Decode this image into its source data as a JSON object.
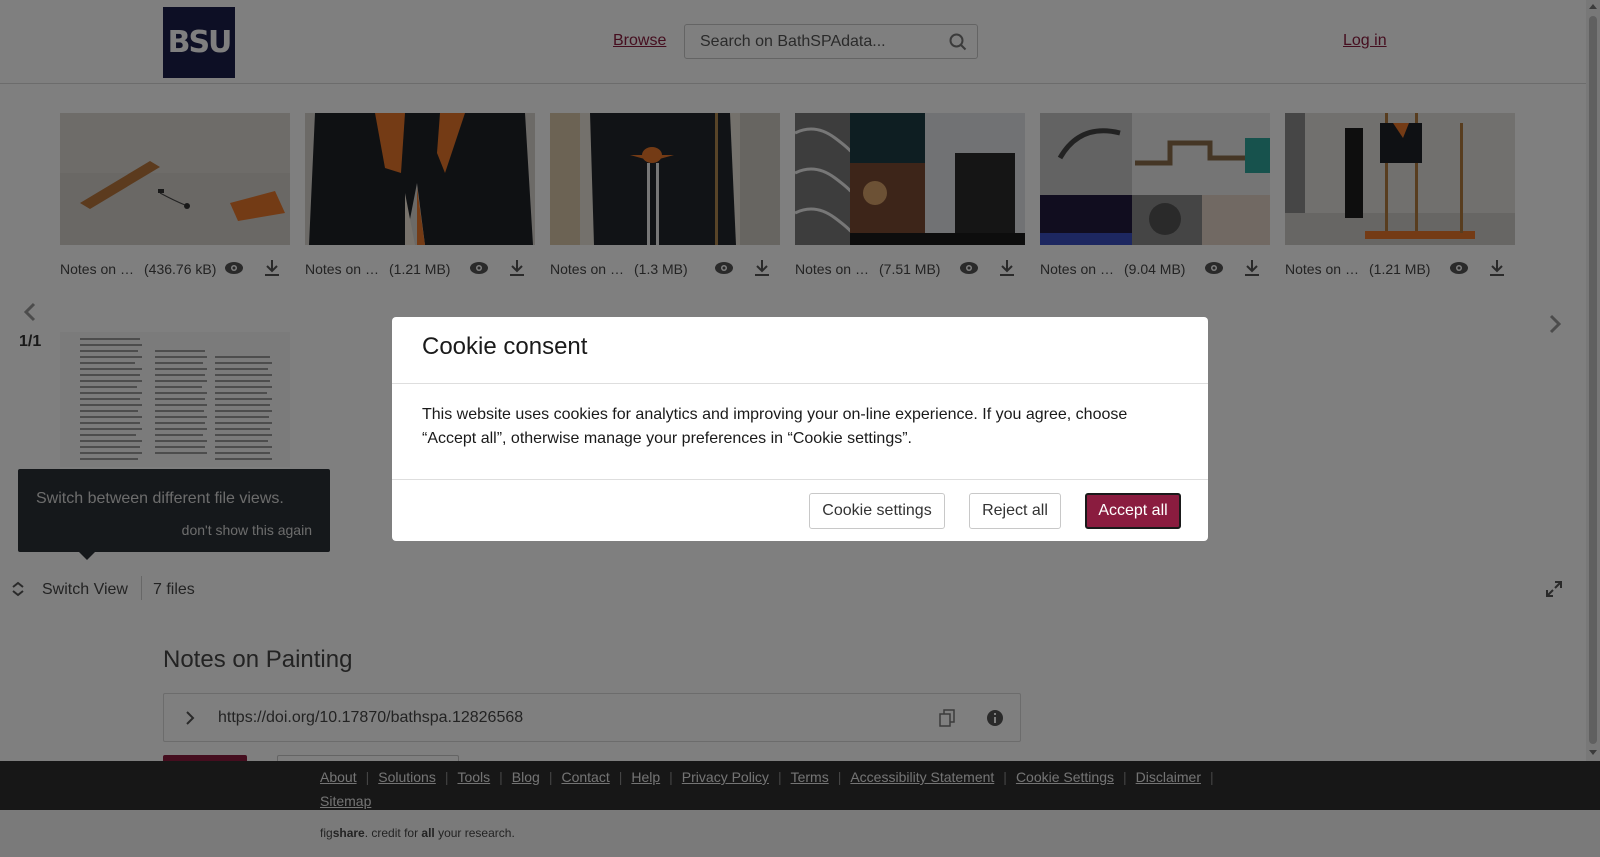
{
  "header": {
    "logo_text": "BSU",
    "browse": "Browse",
    "search_placeholder": "Search on BathSPAdata...",
    "login": "Log in"
  },
  "carousel": {
    "files": [
      {
        "name": "Notes on Painting",
        "size": "(436.76 kB)"
      },
      {
        "name": "Notes on Painting",
        "size": "(1.21 MB)"
      },
      {
        "name": "Notes on Painting",
        "size": "(1.3 MB)"
      },
      {
        "name": "Notes on Painting",
        "size": "(7.51 MB)"
      },
      {
        "name": "Notes on Painting",
        "size": "(9.04 MB)"
      },
      {
        "name": "Notes on Painting",
        "size": "(1.21 MB)"
      }
    ],
    "page_indicator": "1/1",
    "tooltip_text": "Switch between different file views.",
    "tooltip_dismiss": "don't show this again",
    "switch_view": "Switch View",
    "files_count": "7 files"
  },
  "item": {
    "title": "Notes on Painting",
    "doi": "https://doi.org/10.17870/bathspa.12826568"
  },
  "footer": {
    "links": [
      "About",
      "Solutions",
      "Tools",
      "Blog",
      "Contact",
      "Help",
      "Privacy Policy",
      "Terms",
      "Accessibility Statement",
      "Cookie Settings",
      "Disclaimer",
      "Sitemap"
    ],
    "figshare_prefix": "fig",
    "figshare_bold": "share",
    "figshare_mid": ". credit for ",
    "figshare_all": "all",
    "figshare_suffix": " your research."
  },
  "cookie_modal": {
    "title": "Cookie consent",
    "body": "This website uses cookies for analytics and improving your on-line experience. If you agree, choose “Accept all”, otherwise manage your preferences in “Cookie settings”.",
    "settings_button": "Cookie settings",
    "reject_button": "Reject all",
    "accept_button": "Accept all"
  },
  "colors": {
    "accent": "#8a1c3f",
    "logo_bg": "#1b1f4a",
    "footer_bg": "#2f2f2f",
    "tooltip_bg": "#2b3137"
  }
}
